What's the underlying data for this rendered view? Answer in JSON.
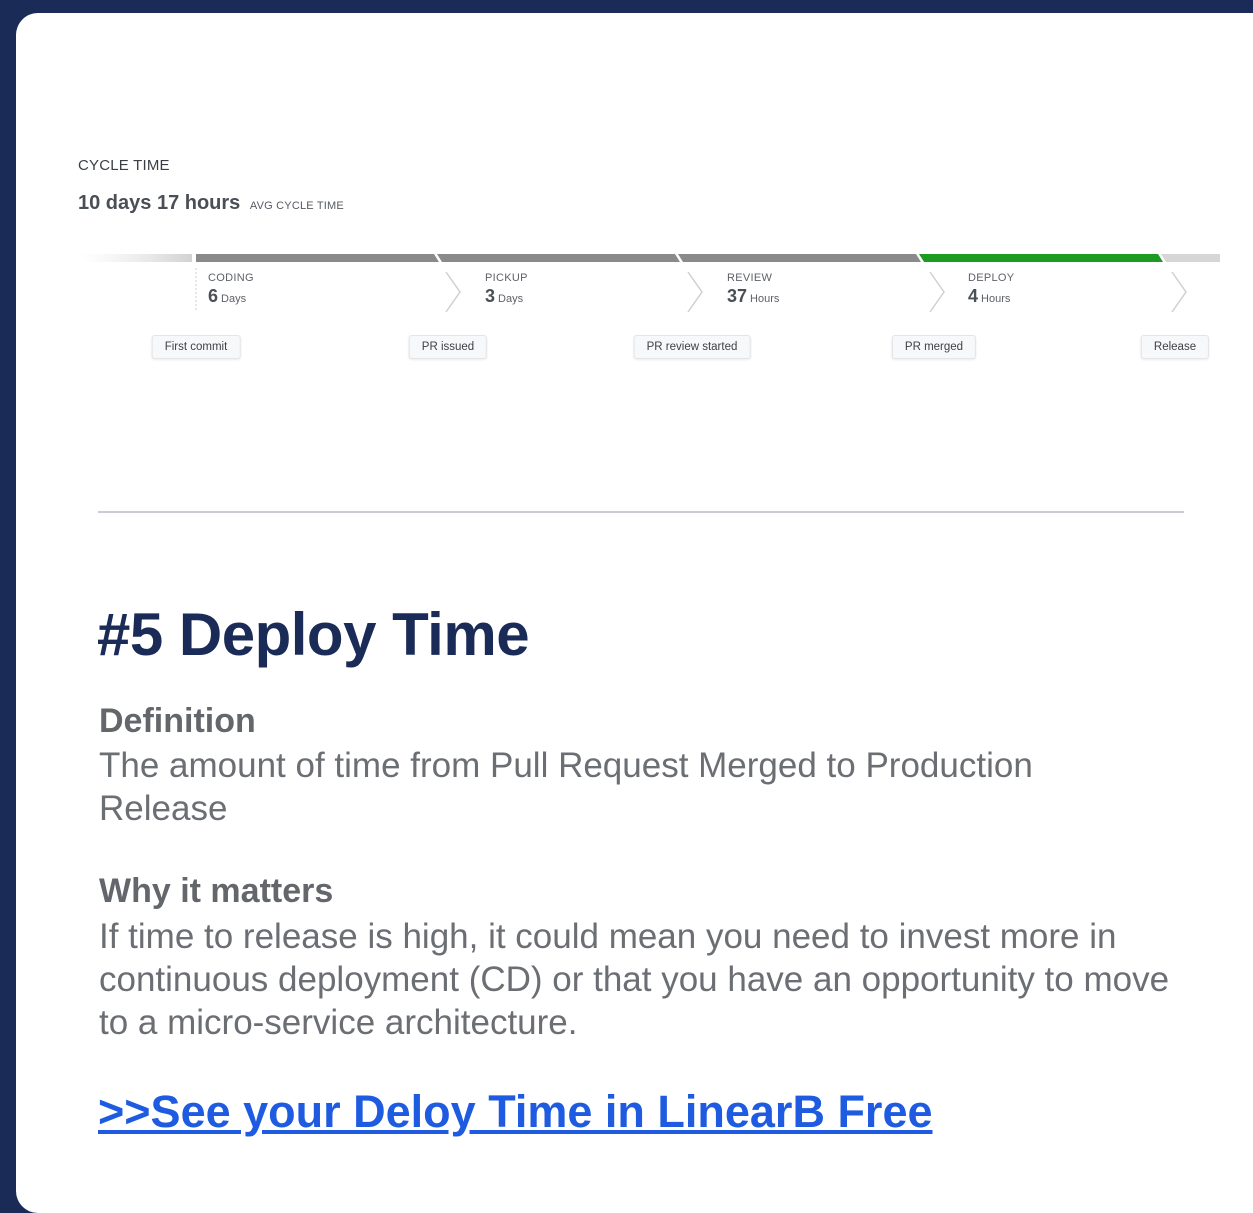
{
  "cycle_time": {
    "title": "CYCLE TIME",
    "avg_value": "10 days 17 hours",
    "avg_label": "AVG CYCLE TIME",
    "stages": [
      {
        "label": "CODING",
        "value": "6",
        "unit": "Days",
        "color": "#8a8a8a"
      },
      {
        "label": "PICKUP",
        "value": "3",
        "unit": "Days",
        "color": "#8a8a8a"
      },
      {
        "label": "REVIEW",
        "value": "37",
        "unit": "Hours",
        "color": "#8a8a8a"
      },
      {
        "label": "DEPLOY",
        "value": "4",
        "unit": "Hours",
        "color": "#1c9a22"
      }
    ],
    "events": [
      "First commit",
      "PR issued",
      "PR review started",
      "PR merged",
      "Release"
    ]
  },
  "article": {
    "heading": "#5 Deploy Time",
    "definition_label": "Definition",
    "definition_text": "The amount of time from Pull Request Merged to Production Release",
    "why_label": "Why it matters",
    "why_text": "If time to release is high, it could mean you need to invest more in continuous deployment (CD) or that you have an opportunity to move to a micro-service architecture.",
    "cta_label": ">>See your Deloy Time in LinearB Free"
  },
  "colors": {
    "background": "#1b2b57",
    "heading": "#1b2b57",
    "link": "#1e5be0",
    "deploy_highlight": "#1c9a22"
  }
}
